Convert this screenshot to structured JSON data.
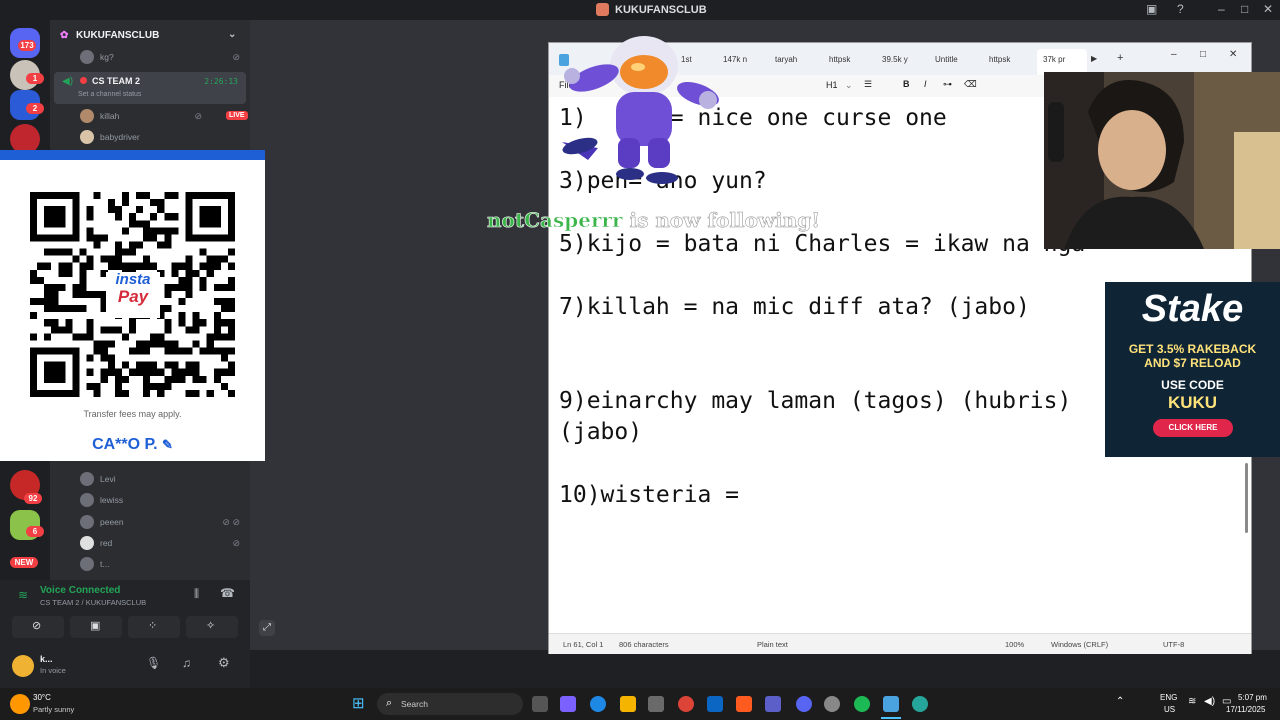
{
  "window": {
    "title": "KUKUFANSCLUB"
  },
  "rail": {
    "badges": [
      "173",
      "1",
      "2",
      "92",
      "6"
    ],
    "new_label": "NEW"
  },
  "sidebar": {
    "server_name": "KUKUFANSCLUB",
    "top_member": "kg?",
    "channel": {
      "name": "CS TEAM 2",
      "timer": "2:26:13",
      "status_hint": "Set a channel status"
    },
    "members": [
      {
        "name": "killah",
        "live": "LIVE"
      },
      {
        "name": "babydriver"
      },
      {
        "name": "Levi"
      },
      {
        "name": "lewiss"
      },
      {
        "name": "peeen"
      },
      {
        "name": "red"
      },
      {
        "name": "t..."
      }
    ]
  },
  "voice": {
    "status": "Voice Connected",
    "channel": "CS TEAM 2 / KUKUFANSCLUB"
  },
  "user": {
    "name": "k...",
    "status": "In voice"
  },
  "qr": {
    "brand_top": "insta",
    "brand_bottom": "Pay",
    "fee_note": "Transfer fees may apply.",
    "account_name": "CA**O P."
  },
  "notepad": {
    "tabs": [
      "1st",
      "147k n",
      "taryah",
      "httpsk",
      "39.5k y",
      "Untitle",
      "httpsk",
      "37k pr"
    ],
    "menu": {
      "file": "File",
      "heading": "H1"
    },
    "lines": [
      {
        "text": "1)",
        "rest": "      = nice one curse one"
      },
      {
        "text": "3)pen= ano yun?"
      },
      {
        "text": "5)kijo = bata ni Charles = ikaw na nga"
      },
      {
        "text": "7)killah = na mic diff ata? (jabo)"
      },
      {
        "text": "9)einarchy may laman (tagos) (hubris)"
      },
      {
        "text": "(jabo)"
      },
      {
        "text": "10)wisteria ="
      }
    ],
    "status": {
      "position": "Ln 61, Col 1",
      "chars": "806 characters",
      "format": "Plain text",
      "zoom": "100%",
      "eol": "Windows (CRLF)",
      "encoding": "UTF-8"
    }
  },
  "overlay": {
    "follower": "notCasperrr",
    "follow_text": "is now following!"
  },
  "ad": {
    "brand": "Stake",
    "line1": "GET 3.5% RAKEBACK",
    "line2": "AND $7 RELOAD",
    "use_code": "USE CODE",
    "code": "KUKU",
    "cta": "CLICK HERE"
  },
  "taskbar": {
    "weather_temp": "30°C",
    "weather_desc": "Partly sunny",
    "search_placeholder": "Search",
    "lang": "ENG",
    "region": "US",
    "time": "5:07 pm",
    "date": "17/11/2025"
  }
}
